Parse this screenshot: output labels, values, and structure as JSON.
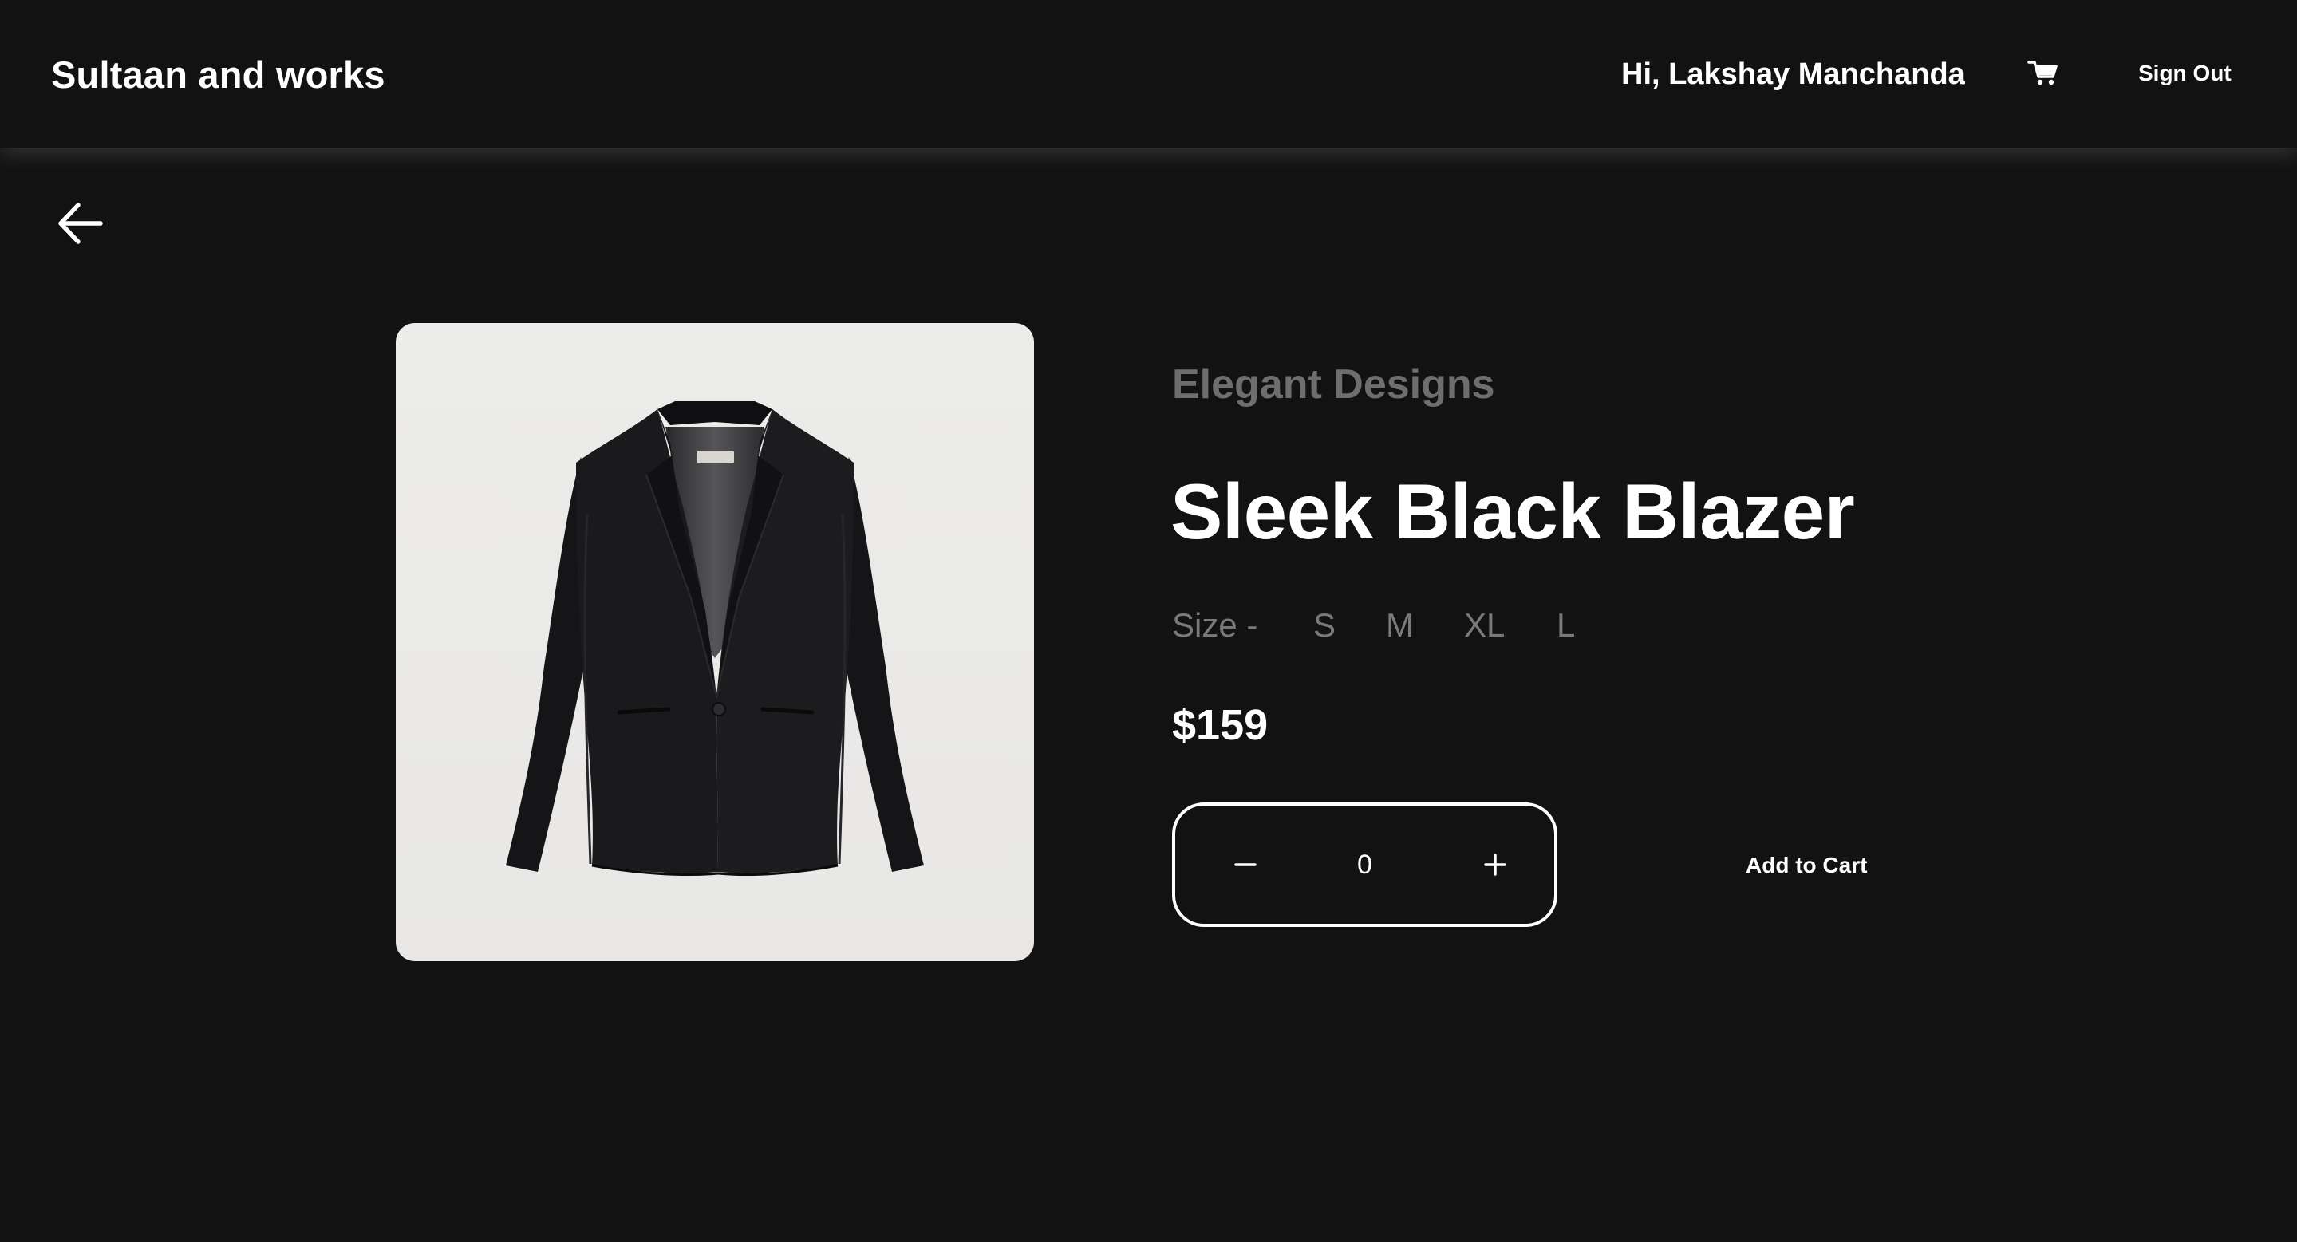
{
  "header": {
    "brand": "Sultaan and works",
    "greeting": "Hi, Lakshay Manchanda",
    "cart_icon": "cart-icon",
    "sign_out_label": "Sign Out"
  },
  "navigation": {
    "back_icon": "arrow-left-icon"
  },
  "product": {
    "image_subject": "black-blazer",
    "brand": "Elegant Designs",
    "title": "Sleek Black Blazer",
    "size_label": "Size -",
    "sizes": [
      "S",
      "M",
      "XL",
      "L"
    ],
    "price": "$159",
    "quantity": "0",
    "add_to_cart_label": "Add to Cart"
  },
  "colors": {
    "background": "#121212",
    "text": "#ffffff",
    "muted": "#6e6e6e",
    "image_bg": "#ebeae8"
  }
}
